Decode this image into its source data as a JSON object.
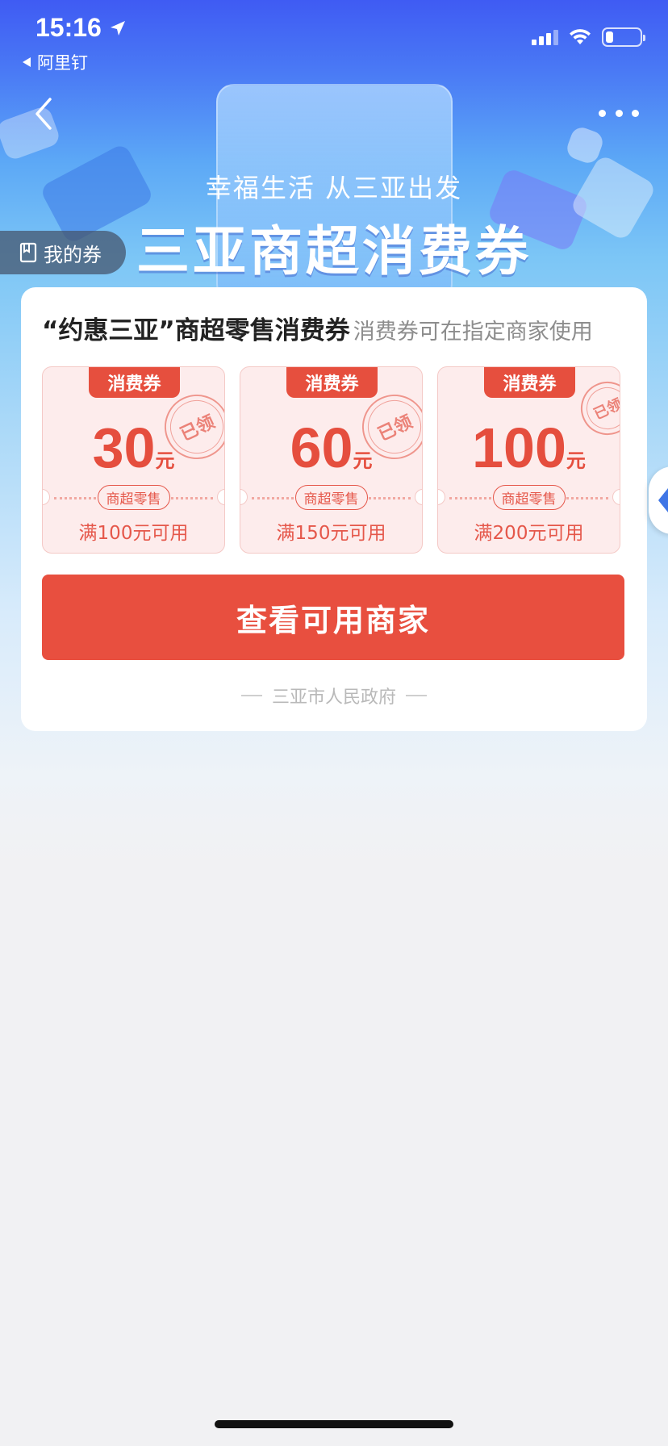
{
  "status_bar": {
    "time": "15:16",
    "back_app": "阿里钉"
  },
  "hero": {
    "subtitle": "幸福生活 从三亚出发",
    "title": "三亚商超消费券"
  },
  "my_coupons_label": "我的券",
  "card": {
    "title": "“约惠三亚”商超零售消费券",
    "note": "消费券可在指定商家使用",
    "coupons": [
      {
        "tag": "消费券",
        "amount": "30",
        "unit": "元",
        "category": "商超零售",
        "condition": "满100元可用",
        "stamp": "已领"
      },
      {
        "tag": "消费券",
        "amount": "60",
        "unit": "元",
        "category": "商超零售",
        "condition": "满150元可用",
        "stamp": "已领"
      },
      {
        "tag": "消费券",
        "amount": "100",
        "unit": "元",
        "category": "商超零售",
        "condition": "满200元可用",
        "stamp": "已领"
      }
    ],
    "cta_label": "查看可用商家",
    "issuer": "三亚市人民政府"
  },
  "colors": {
    "accent_red": "#e84f3f",
    "hero_blue": "#3f5bf3"
  }
}
